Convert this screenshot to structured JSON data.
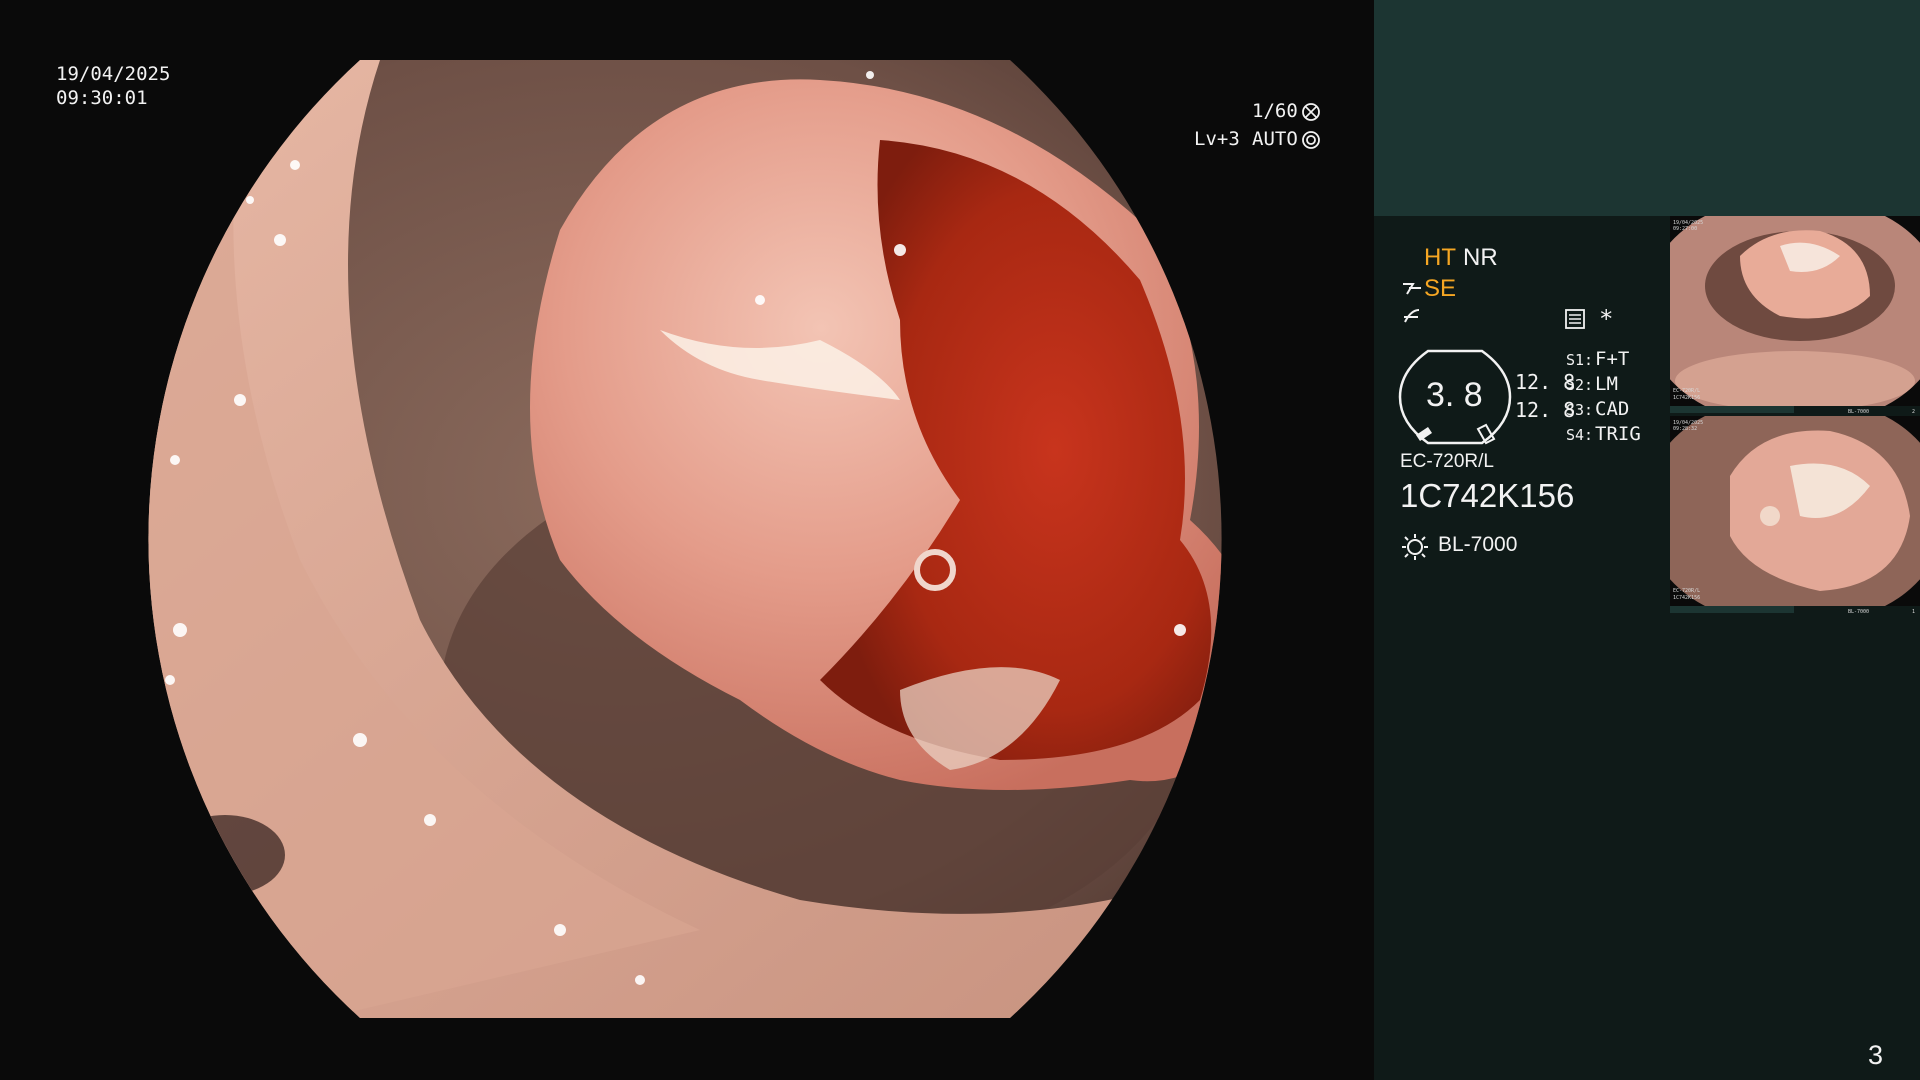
{
  "overlay": {
    "date": "19/04/2025",
    "time": "09:30:01",
    "shutter": "1/60",
    "level": "Lv+3",
    "mode": "AUTO"
  },
  "panel": {
    "ht": "HT",
    "nr": "NR",
    "se": "SE",
    "gauge_value": "3. 8",
    "val_a": "12. 8",
    "val_b": "12. 8",
    "s1_key": "S1:",
    "s1_val": "F+T",
    "s2_key": "S2:",
    "s2_val": "LM",
    "s3_key": "S3:",
    "s3_val": "CAD",
    "s4_key": "S4:",
    "s4_val": "TRIG",
    "asterisk": "*",
    "model": "EC-720R/L",
    "serial": "1C742K156",
    "light_source": "BL-7000",
    "page_number": "3"
  },
  "thumbnails": {
    "t1_date": "19/04/2025",
    "t1_time": "09:27:00",
    "t1_model": "EC-720R/L",
    "t1_serial": "1C742K156",
    "t1_source": "BL-7000",
    "t1_index": "2",
    "t2_date": "19/04/2025",
    "t2_time": "09:28:32",
    "t2_model": "EC-720R/L",
    "t2_serial": "1C742K156",
    "t2_source": "BL-7000",
    "t2_index": "1"
  },
  "colors": {
    "background": "#0a0a0a",
    "panel_top": "#1c3532",
    "panel_body": "#0f1a18",
    "accent": "#f5a623"
  }
}
